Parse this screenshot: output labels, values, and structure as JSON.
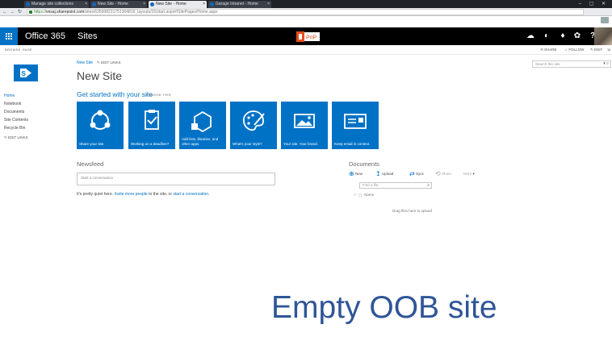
{
  "browser": {
    "tabs": [
      {
        "label": "Manage site collections"
      },
      {
        "label": "New Site - Home"
      },
      {
        "label": "New Site - Home"
      },
      {
        "label": "Garage Intranet - Home"
      }
    ],
    "url_scheme": "https://",
    "url_host": "vesaj.sharepoint.com",
    "url_path": "/sites/63590823175130481f/_layouts/15/start.aspx#/SitePages/Home.aspx"
  },
  "suite_bar": {
    "app_name": "Office 365",
    "section": "Sites",
    "badge": "PnP",
    "icons": [
      "cloud-icon",
      "toggle-icon",
      "bell-icon",
      "gear-icon",
      "help-icon"
    ]
  },
  "ribbon": {
    "tabs": [
      "BROWSE",
      "PAGE"
    ],
    "actions": [
      "SHARE",
      "FOLLOW",
      "EDIT"
    ]
  },
  "site": {
    "breadcrumb": "New Site",
    "edit_links": "EDIT LINKS",
    "title": "New Site",
    "search_placeholder": "Search this site"
  },
  "quick_launch": {
    "items": [
      "Home",
      "Notebook",
      "Documents",
      "Site Contents",
      "Recycle Bin"
    ],
    "edit_links": "EDIT LINKS"
  },
  "get_started": {
    "title": "Get started with your site",
    "remove_label": "REMOVE THIS",
    "tiles": [
      {
        "label": "Share your site.",
        "icon": "share-icon"
      },
      {
        "label": "Working on a deadline?",
        "icon": "clipboard-check-icon"
      },
      {
        "label": "Add lists, libraries, and other apps.",
        "icon": "add-app-icon"
      },
      {
        "label": "What's your style?",
        "icon": "palette-icon"
      },
      {
        "label": "Your site. Your brand.",
        "icon": "brand-picture-icon"
      },
      {
        "label": "Keep email in context.",
        "icon": "mailbox-icon"
      }
    ]
  },
  "newsfeed": {
    "title": "Newsfeed",
    "placeholder": "Start a conversation",
    "quiet_pre": "It's pretty quiet here. ",
    "quiet_invite": "Invite more people",
    "quiet_mid": " to the site, or ",
    "quiet_start": "start a conversation",
    "quiet_end": "."
  },
  "documents": {
    "title": "Documents",
    "commands": {
      "new": "New",
      "upload": "Upload",
      "sync": "Sync",
      "share": "Share",
      "more": "More"
    },
    "find_placeholder": "Find a file",
    "column_name": "Name",
    "drag_message": "Drag files here to upload"
  },
  "caption": "Empty OOB site",
  "colors": {
    "accent": "#0072c6",
    "suite": "#000000",
    "caption": "#2f5597",
    "pnp": "#e74c1c"
  }
}
